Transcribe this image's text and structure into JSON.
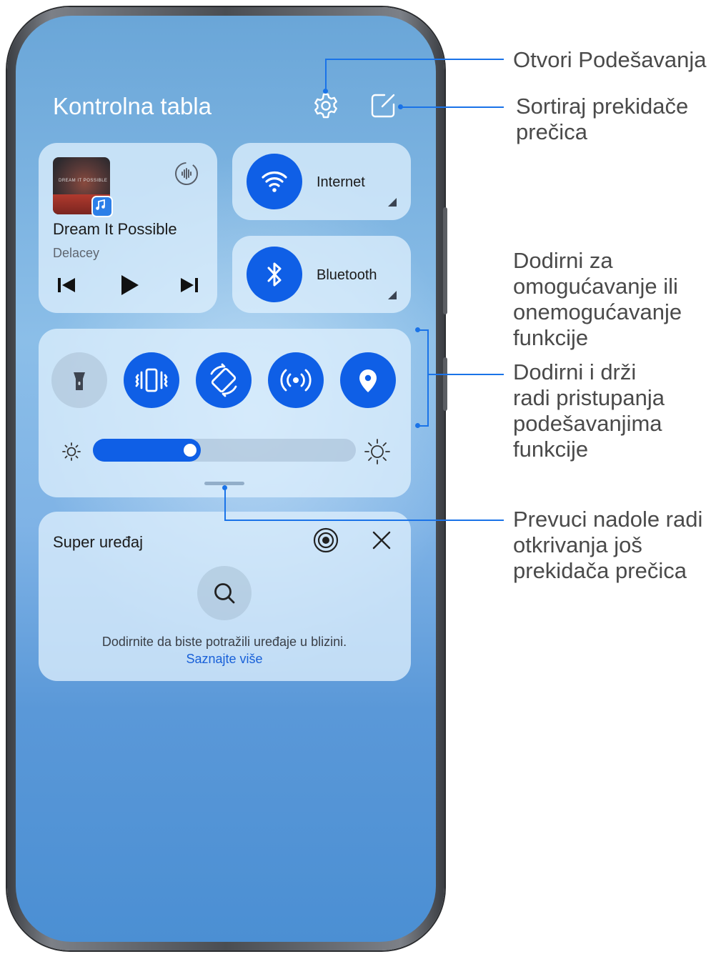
{
  "panel": {
    "title": "Kontrolna tabla"
  },
  "music": {
    "song": "Dream It Possible",
    "artist": "Delacey",
    "art_text": "DREAM IT POSSIBLE"
  },
  "toggles": {
    "internet_label": "Internet",
    "bluetooth_label": "Bluetooth"
  },
  "quick_switches": [
    {
      "name": "flashlight-icon",
      "state": "off"
    },
    {
      "name": "vibration-icon",
      "state": "on"
    },
    {
      "name": "auto-rotate-icon",
      "state": "on"
    },
    {
      "name": "hotspot-icon",
      "state": "on"
    },
    {
      "name": "location-icon",
      "state": "on"
    }
  ],
  "brightness": {
    "level": 0.41
  },
  "super_device": {
    "title": "Super uređaj",
    "description": "Dodirnite da biste potražili uređaje u blizini.",
    "link": "Saznajte više"
  },
  "callouts": {
    "settings": "Otvori Podešavanja",
    "sort": [
      "Sortiraj prekidače",
      "prečica"
    ],
    "toggle": [
      "Dodirni za",
      "omogućavanje ili",
      "onemogućavanje",
      "funkcije"
    ],
    "hold": [
      "Dodirni i drži",
      "radi pristupanja",
      "podešavanjima",
      "funkcije"
    ],
    "swipe": [
      "Prevuci nadole radi",
      "otkrivanja još",
      "prekidača prečica"
    ]
  },
  "colors": {
    "accent": "#0f5fe6",
    "callout_line": "#1a73e8"
  }
}
